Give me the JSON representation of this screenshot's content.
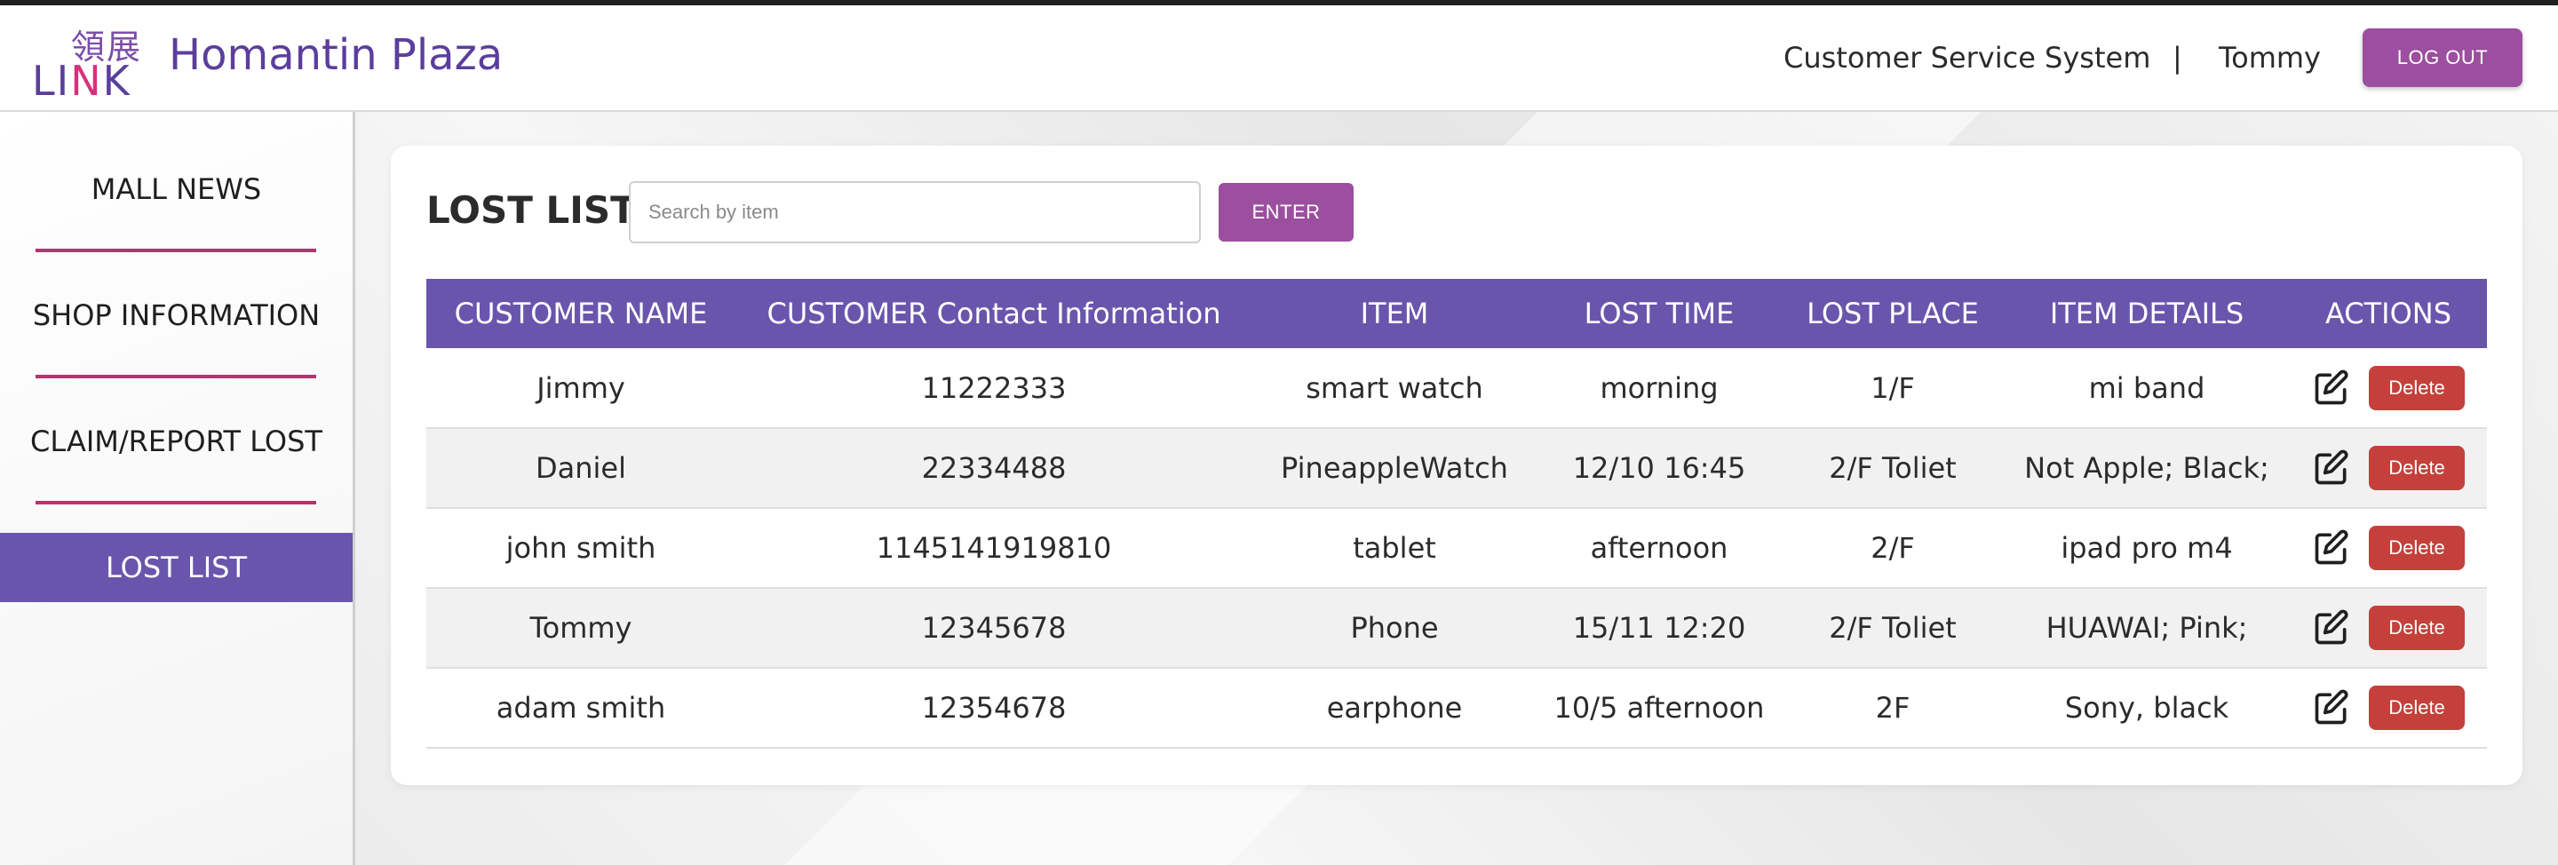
{
  "header": {
    "logo_cjk": "領展",
    "logo_text_left": "LI",
    "logo_text_slash": "N",
    "logo_text_right": "K",
    "site_title": "Homantin Plaza",
    "system_name": "Customer Service System",
    "separator": "|",
    "user_name": "Tommy",
    "logout_label": "LOG OUT"
  },
  "sidebar": {
    "items": [
      {
        "label": "MALL NEWS"
      },
      {
        "label": "SHOP INFORMATION"
      },
      {
        "label": "CLAIM/REPORT LOST"
      },
      {
        "label": "LOST LIST"
      }
    ],
    "active_item": "LOST LIST"
  },
  "main": {
    "title": "LOST LIST",
    "search": {
      "placeholder": "Search by item",
      "value": ""
    },
    "enter_label": "ENTER",
    "table": {
      "columns": [
        "CUSTOMER NAME",
        "CUSTOMER Contact Information",
        "ITEM",
        "LOST TIME",
        "LOST PLACE",
        "ITEM DETAILS",
        "ACTIONS"
      ],
      "rows": [
        {
          "name": "Jimmy",
          "contact": "11222333",
          "item": "smart watch",
          "time": "morning",
          "place": "1/F",
          "details": "mi band"
        },
        {
          "name": "Daniel",
          "contact": "22334488",
          "item": "PineappleWatch",
          "time": "12/10 16:45",
          "place": "2/F Toliet",
          "details": "Not Apple; Black;"
        },
        {
          "name": "john smith",
          "contact": "1145141919810",
          "item": "tablet",
          "time": "afternoon",
          "place": "2/F",
          "details": "ipad pro m4"
        },
        {
          "name": "Tommy",
          "contact": "12345678",
          "item": "Phone",
          "time": "15/11 12:20",
          "place": "2/F Toliet",
          "details": "HUAWAI; Pink;"
        },
        {
          "name": "adam smith",
          "contact": "12354678",
          "item": "earphone",
          "time": "10/5 afternoon",
          "place": "2F",
          "details": "Sony, black"
        }
      ],
      "edit_icon": "edit-icon",
      "delete_label": "Delete"
    }
  },
  "colors": {
    "brand_purple": "#6a55ad",
    "button_purple": "#9b4f9e",
    "divider_magenta": "#b8326f",
    "delete_red": "#c4403a"
  }
}
